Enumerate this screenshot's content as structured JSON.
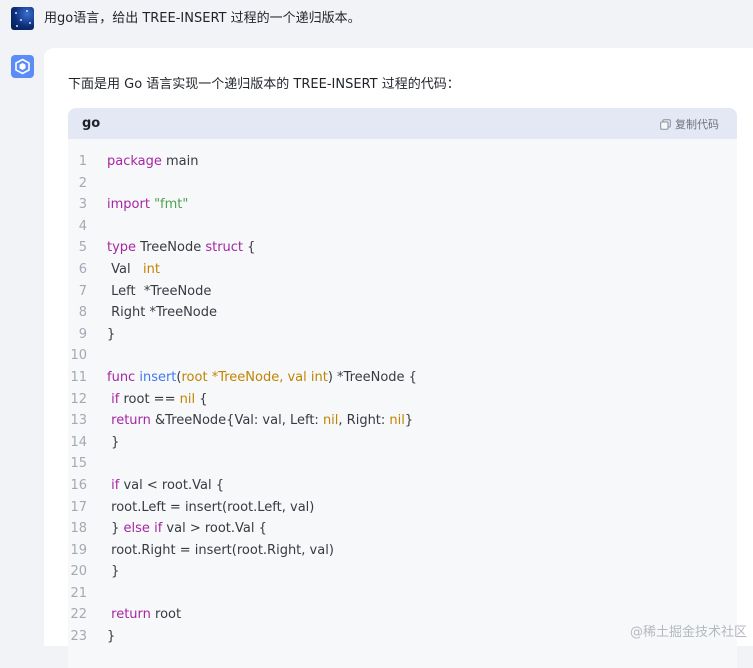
{
  "user": {
    "message": "用go语言，给出 TREE-INSERT 过程的一个递归版本。"
  },
  "answer": {
    "intro": "下面是用 Go 语言实现一个递归版本的 TREE-INSERT 过程的代码：",
    "code": {
      "language": "go",
      "copy_label": "复制代码",
      "lines": [
        {
          "n": "1"
        },
        {
          "n": "2"
        },
        {
          "n": "3"
        },
        {
          "n": "4"
        },
        {
          "n": "5"
        },
        {
          "n": "6"
        },
        {
          "n": "7"
        },
        {
          "n": "8"
        },
        {
          "n": "9"
        },
        {
          "n": "10"
        },
        {
          "n": "11"
        },
        {
          "n": "12"
        },
        {
          "n": "13"
        },
        {
          "n": "14"
        },
        {
          "n": "15"
        },
        {
          "n": "16"
        },
        {
          "n": "17"
        },
        {
          "n": "18"
        },
        {
          "n": "19"
        },
        {
          "n": "20"
        },
        {
          "n": "21"
        },
        {
          "n": "22"
        },
        {
          "n": "23"
        }
      ],
      "tokens": {
        "l1": [
          "package",
          " main"
        ],
        "l3": [
          "import",
          " ",
          "\"fmt\""
        ],
        "l5": [
          "type",
          " TreeNode ",
          "struct",
          " {"
        ],
        "l6": [
          " Val   ",
          "int"
        ],
        "l7": [
          " Left  *TreeNode"
        ],
        "l8": [
          " Right *TreeNode"
        ],
        "l9": [
          "}"
        ],
        "l11": [
          "func",
          " ",
          "insert",
          "(",
          "root *TreeNode, val int",
          ") *TreeNode {"
        ],
        "l12": [
          " ",
          "if",
          " root == ",
          "nil",
          " {"
        ],
        "l13": [
          " ",
          "return",
          " &TreeNode{Val: val, Left: ",
          "nil",
          ", Right: ",
          "nil",
          "}"
        ],
        "l14": [
          " }"
        ],
        "l16": [
          " ",
          "if",
          " val < root.Val {"
        ],
        "l17": [
          " root.Left = insert(root.Left, val)"
        ],
        "l18": [
          " } ",
          "else",
          " ",
          "if",
          " val > root.Val {"
        ],
        "l19": [
          " root.Right = insert(root.Right, val)"
        ],
        "l20": [
          " }"
        ],
        "l22": [
          " ",
          "return",
          " root"
        ],
        "l23": [
          "}"
        ]
      }
    }
  },
  "watermark": "@稀土掘金技术社区",
  "colors": {
    "keyword": "#a626a4",
    "type": "#c18401",
    "string": "#50a14f",
    "function": "#4078f2",
    "header_bg": "#e4e8f4"
  },
  "icons": {
    "user_avatar": "starry-avatar-icon",
    "bot_avatar": "cube-logo-icon",
    "copy": "copy-icon"
  }
}
